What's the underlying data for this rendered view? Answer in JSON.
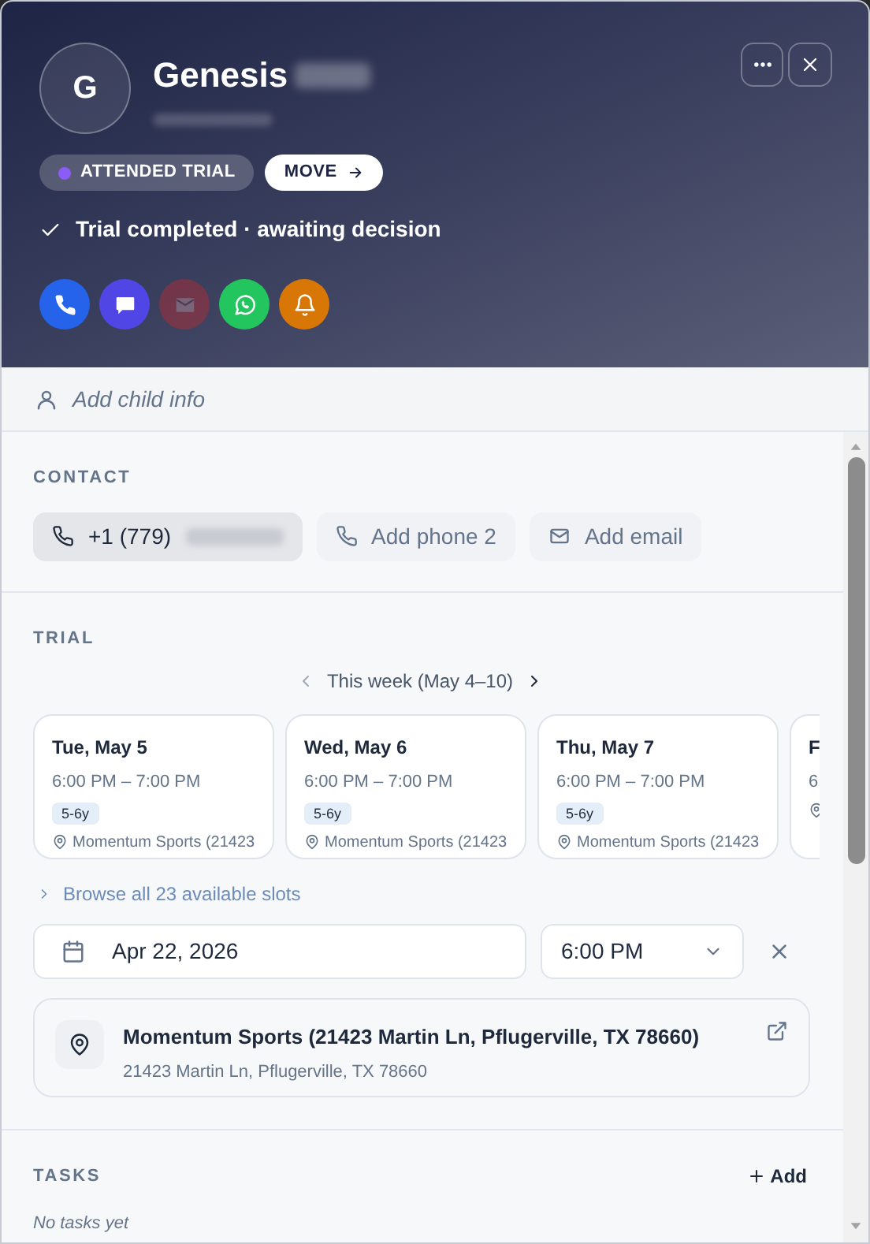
{
  "header": {
    "initial": "G",
    "name": "Genesis",
    "status": {
      "label": "ATTENDED TRIAL",
      "color": "#8b5cf6"
    },
    "move_button": "MOVE",
    "status_note": "Trial completed · awaiting decision",
    "actions": [
      {
        "kind": "phone",
        "disabled": false
      },
      {
        "kind": "message",
        "disabled": false
      },
      {
        "kind": "email",
        "disabled": true
      },
      {
        "kind": "whatsapp",
        "disabled": false
      },
      {
        "kind": "reminder",
        "disabled": false
      }
    ]
  },
  "child_info": {
    "label": "Add child info"
  },
  "contact": {
    "title": "CONTACT",
    "chips": [
      {
        "kind": "phone",
        "label": "+1 (779)",
        "filled": true
      },
      {
        "kind": "phone",
        "label": "Add phone 2",
        "filled": false
      },
      {
        "kind": "email",
        "label": "Add email",
        "filled": false
      }
    ]
  },
  "trial": {
    "title": "TRIAL",
    "week": "This week (May 4–10)",
    "slots": [
      {
        "day": "Tue, May 5",
        "time": "6:00 PM – 7:00 PM",
        "age": "5-6y",
        "location": "Momentum Sports (21423"
      },
      {
        "day": "Wed, May 6",
        "time": "6:00 PM – 7:00 PM",
        "age": "5-6y",
        "location": "Momentum Sports (21423"
      },
      {
        "day": "Thu, May 7",
        "time": "6:00 PM – 7:00 PM",
        "age": "5-6y",
        "location": "Momentum Sports (21423"
      },
      {
        "day": "F",
        "time": "6"
      }
    ],
    "browse_link": "Browse all 23 available slots",
    "date": "Apr 22, 2026",
    "time": "6:00 PM",
    "location": {
      "name": "Momentum Sports (21423 Martin Ln, Pflugerville, TX 78660)",
      "address": "21423 Martin Ln, Pflugerville, TX 78660"
    }
  },
  "tasks": {
    "title": "TASKS",
    "add_label": "Add",
    "empty": "No tasks yet"
  }
}
